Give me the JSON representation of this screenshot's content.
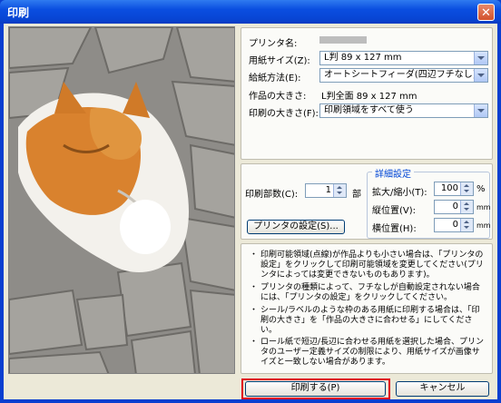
{
  "window": {
    "title": "印刷",
    "close_glyph": "✕"
  },
  "settings": {
    "printer_label": "プリンタ名:",
    "paper_size": {
      "label": "用紙サイズ(Z):",
      "value": "L判 89 x 127 mm"
    },
    "feed": {
      "label": "給紙方法(E):",
      "value": "オートシートフィーダ(四辺フチなし)"
    },
    "work_size": {
      "label": "作品の大きさ:",
      "value": "L判全面 89 x 127 mm"
    },
    "print_size": {
      "label": "印刷の大きさ(F):",
      "value": "印刷領域をすべて使う"
    }
  },
  "copies": {
    "label": "印刷部数(C):",
    "value": "1",
    "unit": "部"
  },
  "detail": {
    "title": "詳細設定",
    "scale": {
      "label": "拡大/縮小(T):",
      "value": "100",
      "unit": "%"
    },
    "vpos": {
      "label": "縦位置(V):",
      "value": "0",
      "unit": "mm"
    },
    "hpos": {
      "label": "横位置(H):",
      "value": "0",
      "unit": "mm"
    }
  },
  "printer_settings_button": "プリンタの設定(S)...",
  "notes": [
    {
      "bullet": "・",
      "text": "印刷可能領域(点線)が作品よりも小さい場合は、「プリンタの設定」をクリックして印刷可能領域を変更してください(プリンタによっては変更できないものもあります)。"
    },
    {
      "bullet": "・",
      "text": "プリンタの種類によって、フチなしが自動設定されない場合には、「プリンタの設定」をクリックしてください。"
    },
    {
      "bullet": "・",
      "text": "シール/ラベルのような枠のある用紙に印刷する場合は、「印刷の大きさ」を「作品の大きさに合わせる」にしてください。"
    },
    {
      "bullet": "・",
      "text": "ロール紙で短辺/長辺に合わせる用紙を選択した場合、プリンタのユーザー定義サイズの制限により、用紙サイズが画像サイズと一致しない場合があります。"
    }
  ],
  "buttons": {
    "print": "印刷する(P)",
    "cancel": "キャンセル"
  },
  "colors": {
    "titlebar": "#0a4ee0",
    "highlight": "#e0001b",
    "group_title": "#0046d5"
  }
}
